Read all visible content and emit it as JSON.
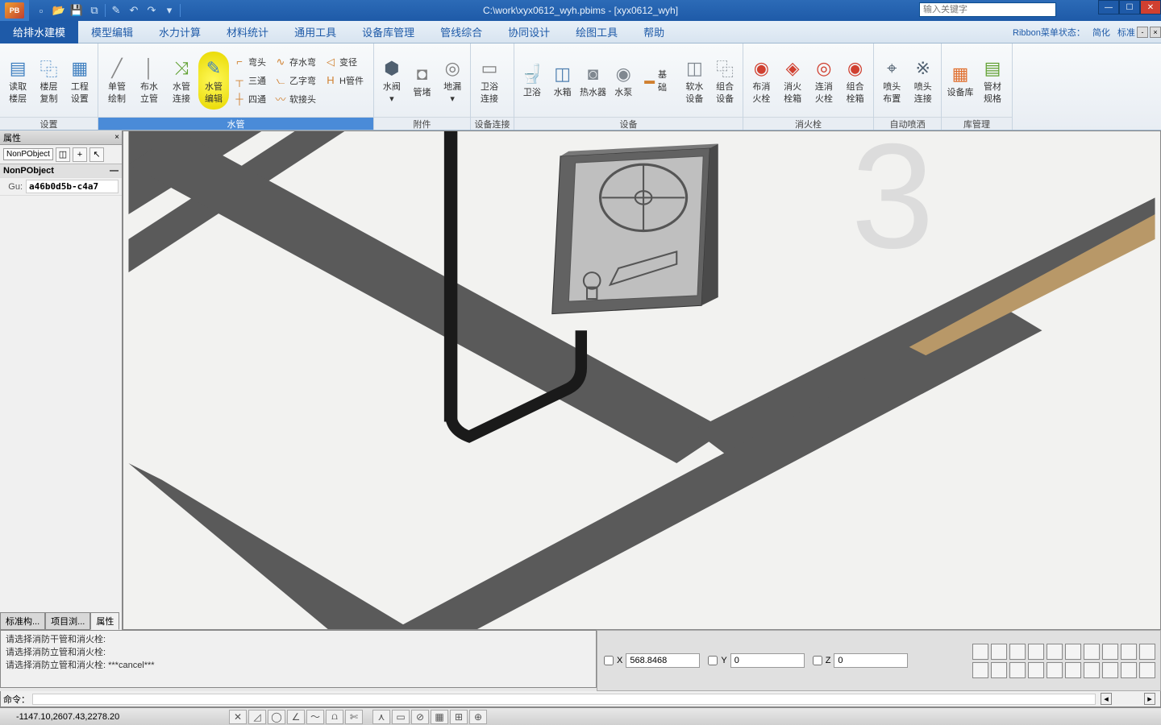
{
  "title": "C:\\work\\xyx0612_wyh.pbims - [xyx0612_wyh]",
  "search_placeholder": "输入关键字",
  "qat": [
    "new",
    "open",
    "save",
    "save-all",
    "refresh",
    "undo",
    "redo",
    "dropdown"
  ],
  "ribbon": {
    "status_label": "Ribbon菜单状态：",
    "status_modes": [
      "简化",
      "标准"
    ],
    "tabs": [
      "给排水建模",
      "模型编辑",
      "水力计算",
      "材料统计",
      "通用工具",
      "设备库管理",
      "管线综合",
      "协同设计",
      "绘图工具",
      "帮助"
    ],
    "active_tab": 0,
    "groups": [
      {
        "label": "设置",
        "active": false,
        "large": [
          {
            "line1": "读取",
            "line2": "楼层"
          },
          {
            "line1": "楼层",
            "line2": "复制"
          },
          {
            "line1": "工程",
            "line2": "设置"
          }
        ]
      },
      {
        "label": "水管",
        "active": true,
        "large": [
          {
            "line1": "单管",
            "line2": "绘制"
          },
          {
            "line1": "布水",
            "line2": "立管"
          },
          {
            "line1": "水管",
            "line2": "连接"
          },
          {
            "line1": "水管",
            "line2": "编辑",
            "highlight": true
          }
        ],
        "small": [
          {
            "t": "弯头"
          },
          {
            "t": "存水弯"
          },
          {
            "t": "变径"
          },
          {
            "t": "三通"
          },
          {
            "t": "乙字弯"
          },
          {
            "t": "H管件"
          },
          {
            "t": "四通"
          },
          {
            "t": "软接头"
          },
          {
            "t": ""
          }
        ]
      },
      {
        "label": "附件",
        "active": false,
        "large": [
          {
            "line1": "水阀",
            "line2": ""
          },
          {
            "line1": "管堵",
            "line2": ""
          },
          {
            "line1": "地漏",
            "line2": ""
          }
        ]
      },
      {
        "label": "设备连接",
        "active": false,
        "large": [
          {
            "line1": "卫浴",
            "line2": "连接"
          }
        ]
      },
      {
        "label": "设备",
        "active": false,
        "large": [
          {
            "line1": "卫浴",
            "line2": ""
          },
          {
            "line1": "水箱",
            "line2": ""
          },
          {
            "line1": "热水器",
            "line2": ""
          },
          {
            "line1": "水泵",
            "line2": ""
          }
        ],
        "small": [
          {
            "t": "基础"
          }
        ],
        "extra": [
          {
            "line1": "软水",
            "line2": "设备"
          },
          {
            "line1": "组合",
            "line2": "设备"
          }
        ]
      },
      {
        "label": "消火栓",
        "active": false,
        "large": [
          {
            "line1": "布消",
            "line2": "火栓"
          },
          {
            "line1": "消火",
            "line2": "栓箱"
          },
          {
            "line1": "连消",
            "line2": "火栓"
          },
          {
            "line1": "组合",
            "line2": "栓箱"
          }
        ]
      },
      {
        "label": "自动喷洒",
        "active": false,
        "large": [
          {
            "line1": "喷头",
            "line2": "布置"
          },
          {
            "line1": "喷头",
            "line2": "连接"
          }
        ]
      },
      {
        "label": "库管理",
        "active": false,
        "large": [
          {
            "line1": "设备库",
            "line2": ""
          },
          {
            "line1": "管材",
            "line2": "规格"
          }
        ]
      }
    ]
  },
  "properties": {
    "title": "属性",
    "selector": "NonPObject",
    "header": "NonPObject",
    "rows": [
      {
        "k": "Gu:",
        "v": "a46b0d5b-c4a7"
      }
    ],
    "tabs": [
      "标准构...",
      "项目浏...",
      "属性"
    ],
    "active_tab": 2
  },
  "command_log": [
    "请选择消防干管和消火栓:",
    "请选择消防立管和消火栓:",
    "请选择消防立管和消火栓: ***cancel***"
  ],
  "command_prompt": "命令：",
  "coords": {
    "x": {
      "label": "X",
      "value": "568.8468"
    },
    "y": {
      "label": "Y",
      "value": "0"
    },
    "z": {
      "label": "Z",
      "value": "0"
    }
  },
  "status_coords": "-1147.10,2607.43,2278.20",
  "viewport": {
    "bg_number": "3"
  }
}
